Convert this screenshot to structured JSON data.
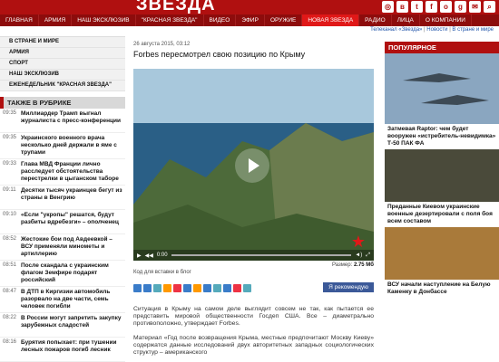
{
  "brand": {
    "logo_text": "ЗВЕЗДА",
    "accent": "#b01010"
  },
  "social_icons": [
    "instagram-icon",
    "vk-icon",
    "twitter-icon",
    "facebook-icon",
    "ok-icon",
    "google-plus-icon",
    "comment-icon",
    "search-icon"
  ],
  "nav": [
    "ГЛАВНАЯ",
    "АРМИЯ",
    "НАШ ЭКСКЛЮЗИВ",
    "\"КРАСНАЯ ЗВЕЗДА\"",
    "ВИДЕО",
    "ЭФИР",
    "ОРУЖИЕ",
    "НОВАЯ ЗВЕЗДА",
    "РАДИО",
    "ЛИЦА",
    "О КОМПАНИИ"
  ],
  "breadcrumb": {
    "a": "Телеканал «Звезда»",
    "b": "Новости",
    "c": "В стране и мире"
  },
  "categories": [
    "В СТРАНЕ И МИРЕ",
    "АРМИЯ",
    "СПОРТ",
    "НАШ ЭКСКЛЮЗИВ",
    "ЕЖЕНЕДЕЛЬНИК \"КРАСНАЯ ЗВЕЗДА\""
  ],
  "rubric_title": "ТАКЖЕ В РУБРИКЕ",
  "rubric": [
    {
      "time": "09:35",
      "text": "Миллиардер Трамп выгнал журналиста с пресс-конференции"
    },
    {
      "time": "09:35",
      "text": "Украинского военного врача несколько дней держали в яме с трупами"
    },
    {
      "time": "09:33",
      "text": "Глава МВД Франции лично расследует обстоятельства перестрелки в цыганском таборе"
    },
    {
      "time": "09:11",
      "text": "Десятки тысяч украинцев бегут из страны в Венгрию"
    },
    {
      "time": "09:10",
      "text": "«Если \"укропы\" решатся, будут разбиты вдребезги» – ополченец"
    },
    {
      "time": "08:52",
      "text": "Жестокие бои под Авдеевкой – ВСУ применяли минометы и артиллерию"
    },
    {
      "time": "08:51",
      "text": "После скандала с украинским флагом Земфире подарят российский"
    },
    {
      "time": "08:47",
      "text": "В ДТП в Киргизии автомобиль разорвало на две части, семь человек погибли"
    },
    {
      "time": "08:22",
      "text": "В России могут запретить закупку зарубежных сладостей"
    },
    {
      "time": "08:16",
      "text": "Бурятия попыхает: при тушении лесных пожаров погиб лесник"
    }
  ],
  "article": {
    "date": "26 августа 2015, 03:12",
    "title": "Forbes пересмотрел свою позицию по Крыму",
    "video_time": "0:00",
    "video_size_label": "Размер:",
    "video_size": "2.75 Мб",
    "embed_label": "Код для вставки в блог",
    "recommend": "Я рекомендую",
    "p1": "Ситуация в Крыму на самом деле выглядит совсем не так, как пытается ее представить мировой общественности Госдеп США. Все – диаметрально противоположно, утверждает Forbes.",
    "p2": "Материал «Год после возвращения Крыма, местные предпочитают Москву Киеву» содержатся данные исследований двух авторитетных западных социологических структур – американского"
  },
  "popular": {
    "title": "ПОПУЛЯРНОЕ",
    "items": [
      {
        "text": "Затмевая Raptor: чем будет вооружен «истребитель-невидимка» Т-50 ПАК ФА"
      },
      {
        "text": "Преданные Киевом украинские военные дезертировали с поля боя всем составом"
      },
      {
        "text": "ВСУ начали наступление на Белую Каменку в Донбассе"
      }
    ]
  }
}
